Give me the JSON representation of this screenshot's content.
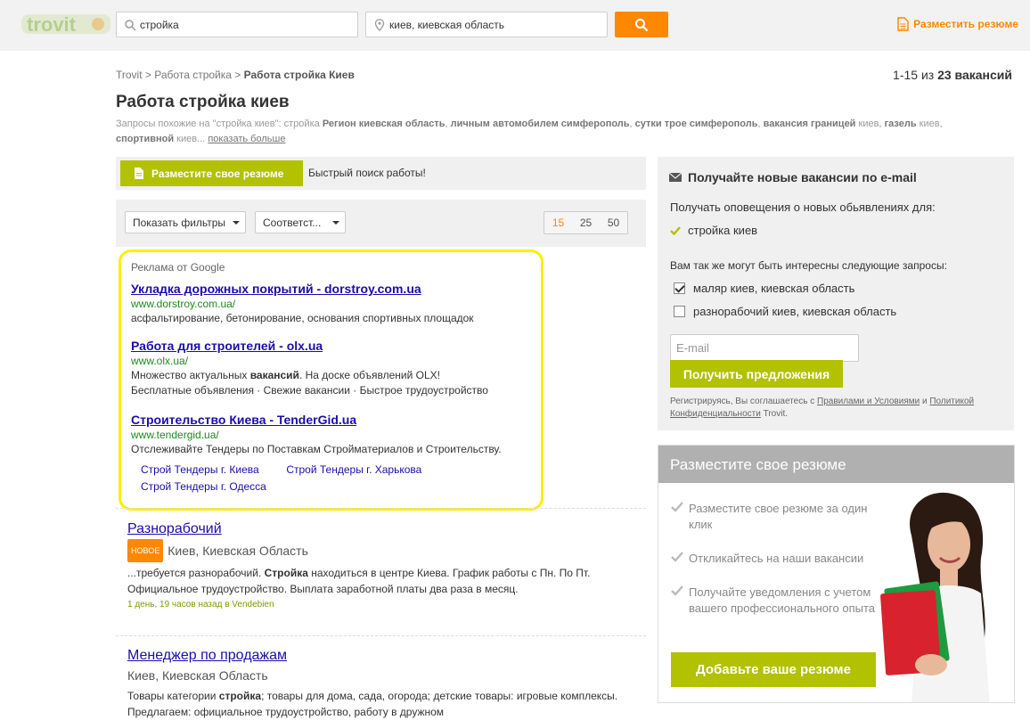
{
  "header": {
    "logo_text": "trovit",
    "search_what_value": "стройка",
    "search_where_value": "киев, киевская область",
    "post_cv_label": "Разместить резюме"
  },
  "breadcrumb": {
    "items": [
      "Trovit",
      "Работа стройка"
    ],
    "separator": ">",
    "current": "Работа стройка Киев"
  },
  "results_count": {
    "range": "1-15 из",
    "total": "23 вакансий"
  },
  "page_title": "Работа стройка киев",
  "related": {
    "prefix": "Запросы похожие на \"стройка киев\": стройка",
    "q1": "Регион киевская область",
    "q2": "личным автомобилем симферополь",
    "q3": "сутки трое симферополь",
    "q4": "вакансия границей",
    "q4_suffix": "киев,",
    "q5": "газель",
    "q5_suffix": "киев,",
    "q6": "спортивной",
    "q6_suffix": "киев...",
    "more": "показать больше"
  },
  "cv_bar": {
    "button": "Разместите свое резюме",
    "text": "Быстрый поиск работы!"
  },
  "filters": {
    "show_filters": "Показать фильтры",
    "sort": "Соответст...",
    "page_sizes": [
      "15",
      "25",
      "50"
    ]
  },
  "ads": {
    "header": "Реклама от Google",
    "items": [
      {
        "title": "Укладка дорожных покрытий - dorstroy.com.ua",
        "url": "www.dorstroy.com.ua/",
        "desc": "асфальтирование, бетонирование, основания спортивных площадок"
      },
      {
        "title": "Работа для строителей - olx.ua",
        "url": "www.olx.ua/",
        "desc_pre": "Множество актуальных ",
        "desc_bold": "вакансий",
        "desc_post": ". На доске объявлений OLX!",
        "desc2": "Бесплатные объявления · Свежие вакансии · Быстрое трудоустройство"
      },
      {
        "title_pre": "Строительство ",
        "title_bold": "Киева",
        "title_post": " - TenderGid.ua",
        "url": "www.tendergid.ua/",
        "desc": "Отслеживайте Тендеры по Поставкам Стройматериалов и Строительству."
      }
    ],
    "sublinks": [
      "Строй Тендеры г. Киева",
      "Строй Тендеры г. Харькова",
      "Строй Тендеры г. Одесса"
    ]
  },
  "jobs": [
    {
      "title": "Разнорабочий",
      "badge": "НОВОЕ",
      "location": "Киев, Киевская Область",
      "desc_pre": "...требуется разнорабочий. ",
      "desc_bold": "Стройка",
      "desc_post": " находиться в центре Киева. График работы с Пн. По Пт. Официальное трудоустройство. Выплата заработной платы два раза в месяц.",
      "meta": "1 день, 19 часов назад в Vendebien"
    },
    {
      "title": "Менеджер по продажам",
      "location": "Киев, Киевская Область",
      "desc_pre": "Товары категории ",
      "desc_bold": "стройка",
      "desc_post": "; товары для дома, сада, огорода; детские товары: игровые комплексы. Предлагаем: официальное трудоустройство, работу в дружном"
    }
  ],
  "alerts": {
    "title": "Получайте новые вакансии по e-mail",
    "subtitle": "Получать оповещения о новых обьявлениях для:",
    "current_query": "стройка киев",
    "also_title": "Вам так же могут быть интересны следующие запросы:",
    "options": [
      {
        "label": "маляр киев, киевская область",
        "checked": true
      },
      {
        "label": "разнорабочий киев, киевская область",
        "checked": false
      }
    ],
    "email_placeholder": "E-mail",
    "submit": "Получить предложения",
    "terms_pre": "Регистрируясь, Вы соглашаетесь с ",
    "terms_link1": "Правилами и Условиями",
    "terms_mid": " и ",
    "terms_link2": "Политикой Конфиденциальности",
    "terms_post": " Trovit."
  },
  "cv_promo": {
    "title": "Разместите свое резюме",
    "points": [
      "Разместите свое резюме за один клик",
      "Откликайтесь на наши вакансии",
      "Получайте уведомления с учетом вашего профессионального опыта"
    ],
    "button": "Добавьте ваше резюме"
  },
  "colors": {
    "accent": "#ff8800",
    "green": "#b2c100",
    "link": "#1a0dab",
    "ad_border": "#ffee00"
  }
}
